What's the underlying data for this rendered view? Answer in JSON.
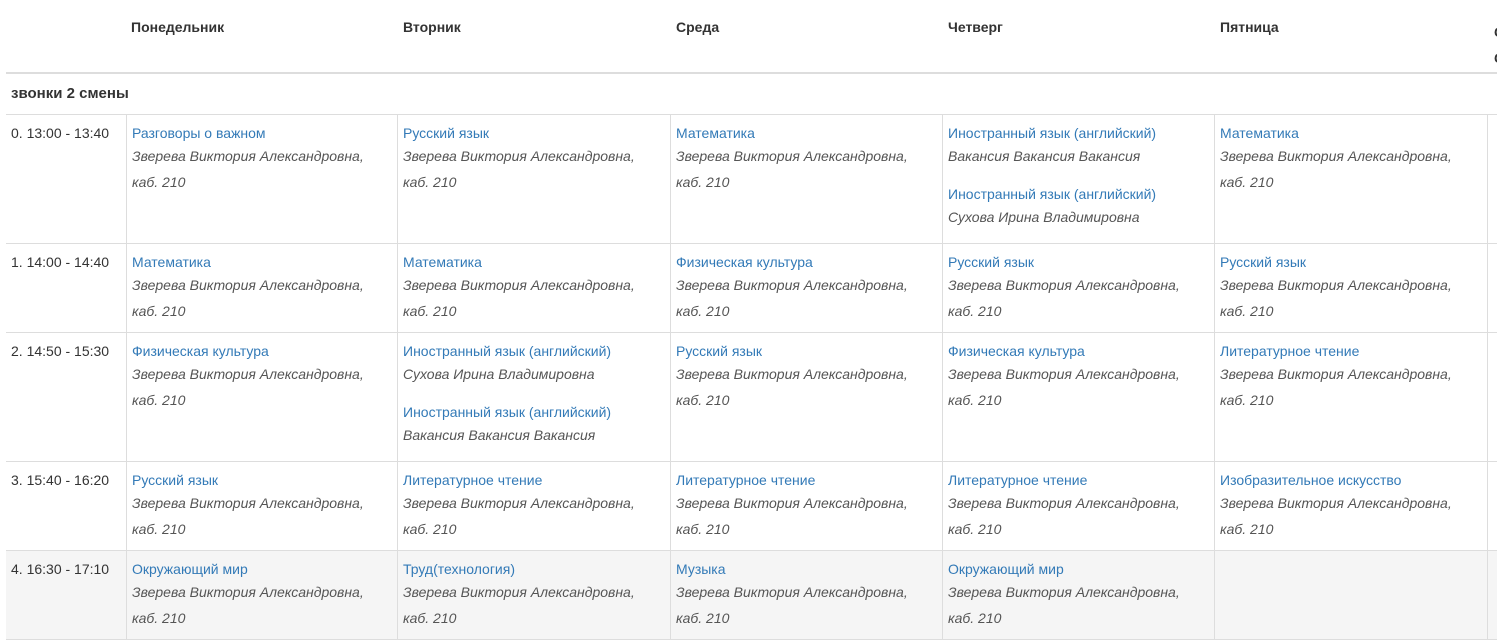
{
  "days": [
    "Понедельник",
    "Вторник",
    "Среда",
    "Четверг",
    "Пятница"
  ],
  "days_cut_partial": "С\nС",
  "shift_title": "звонки 2 смены",
  "lessons": [
    {
      "time": "0. 13:00 - 13:40",
      "cells": [
        [
          {
            "subject": "Разговоры о важном",
            "teacher": "Зверева Виктория Александровна,",
            "room": "каб. 210"
          }
        ],
        [
          {
            "subject": "Русский язык",
            "teacher": "Зверева Виктория Александровна,",
            "room": "каб. 210"
          }
        ],
        [
          {
            "subject": "Математика",
            "teacher": "Зверева Виктория Александровна,",
            "room": "каб. 210"
          }
        ],
        [
          {
            "subject": "Иностранный язык (английский)",
            "teacher": "Вакансия Вакансия Вакансия",
            "room": ""
          },
          {
            "subject": "Иностранный язык (английский)",
            "teacher": "Сухова Ирина Владимировна",
            "room": ""
          }
        ],
        [
          {
            "subject": "Математика",
            "teacher": "Зверева Виктория Александровна,",
            "room": "каб. 210"
          }
        ]
      ]
    },
    {
      "time": "1. 14:00 - 14:40",
      "cells": [
        [
          {
            "subject": "Математика",
            "teacher": "Зверева Виктория Александровна,",
            "room": "каб. 210"
          }
        ],
        [
          {
            "subject": "Математика",
            "teacher": "Зверева Виктория Александровна,",
            "room": "каб. 210"
          }
        ],
        [
          {
            "subject": "Физическая культура",
            "teacher": "Зверева Виктория Александровна,",
            "room": "каб. 210"
          }
        ],
        [
          {
            "subject": "Русский язык",
            "teacher": "Зверева Виктория Александровна,",
            "room": "каб. 210"
          }
        ],
        [
          {
            "subject": "Русский язык",
            "teacher": "Зверева Виктория Александровна,",
            "room": "каб. 210"
          }
        ]
      ]
    },
    {
      "time": "2. 14:50 - 15:30",
      "cells": [
        [
          {
            "subject": "Физическая культура",
            "teacher": "Зверева Виктория Александровна,",
            "room": "каб. 210"
          }
        ],
        [
          {
            "subject": "Иностранный язык (английский)",
            "teacher": "Сухова Ирина Владимировна",
            "room": ""
          },
          {
            "subject": "Иностранный язык (английский)",
            "teacher": "Вакансия Вакансия Вакансия",
            "room": ""
          }
        ],
        [
          {
            "subject": "Русский язык",
            "teacher": "Зверева Виктория Александровна,",
            "room": "каб. 210"
          }
        ],
        [
          {
            "subject": "Физическая культура",
            "teacher": "Зверева Виктория Александровна,",
            "room": "каб. 210"
          }
        ],
        [
          {
            "subject": "Литературное чтение",
            "teacher": "Зверева Виктория Александровна,",
            "room": "каб. 210"
          }
        ]
      ]
    },
    {
      "time": "3. 15:40 - 16:20",
      "cells": [
        [
          {
            "subject": "Русский язык",
            "teacher": "Зверева Виктория Александровна,",
            "room": "каб. 210"
          }
        ],
        [
          {
            "subject": "Литературное чтение",
            "teacher": "Зверева Виктория Александровна,",
            "room": "каб. 210"
          }
        ],
        [
          {
            "subject": "Литературное чтение",
            "teacher": "Зверева Виктория Александровна,",
            "room": "каб. 210"
          }
        ],
        [
          {
            "subject": "Литературное чтение",
            "teacher": "Зверева Виктория Александровна,",
            "room": "каб. 210"
          }
        ],
        [
          {
            "subject": "Изобразительное искусство",
            "teacher": "Зверева Виктория Александровна,",
            "room": "каб. 210"
          }
        ]
      ]
    },
    {
      "time": "4. 16:30 - 17:10",
      "cells": [
        [
          {
            "subject": "Окружающий мир",
            "teacher": "Зверева Виктория Александровна,",
            "room": "каб. 210"
          }
        ],
        [
          {
            "subject": "Труд(технология)",
            "teacher": "Зверева Виктория Александровна,",
            "room": "каб. 210"
          }
        ],
        [
          {
            "subject": "Музыка",
            "teacher": "Зверева Виктория Александровна,",
            "room": "каб. 210"
          }
        ],
        [
          {
            "subject": "Окружающий мир",
            "teacher": "Зверева Виктория Александровна,",
            "room": "каб. 210"
          }
        ],
        []
      ]
    }
  ]
}
